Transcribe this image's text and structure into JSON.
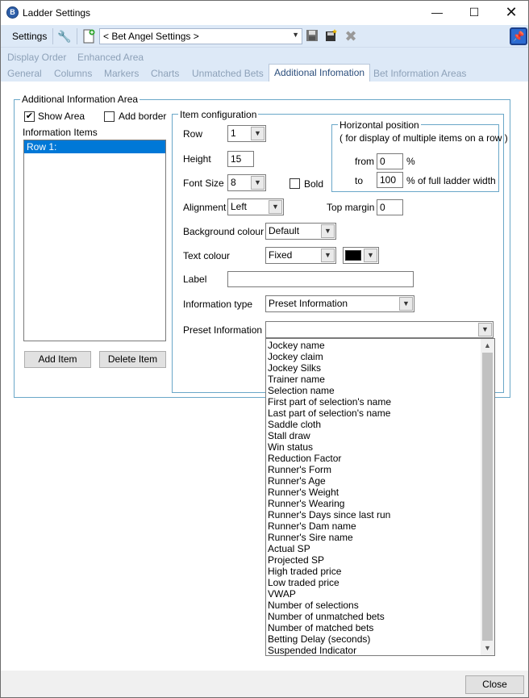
{
  "window": {
    "title": "Ladder Settings"
  },
  "toolbar": {
    "settings_label": "Settings",
    "profile_value": "< Bet Angel Settings >"
  },
  "tabs_row1": [
    "Display Order",
    "Enhanced Area"
  ],
  "tabs_row2": [
    "General",
    "Columns",
    "Markers",
    "Charts",
    "Unmatched Bets",
    "Additional Infomation",
    "Bet Information Areas"
  ],
  "area": {
    "group_label": "Additional Information Area",
    "show_area": "Show Area",
    "add_border": "Add border",
    "items_label": "Information Items",
    "items": [
      "Row 1:"
    ],
    "add_item": "Add Item",
    "delete_item": "Delete Item"
  },
  "config": {
    "group_label": "Item configuration",
    "row_label": "Row",
    "row_value": "1",
    "height_label": "Height",
    "height_value": "15",
    "font_size_label": "Font Size",
    "font_size_value": "8",
    "bold_label": "Bold",
    "alignment_label": "Alignment",
    "alignment_value": "Left",
    "top_margin_label": "Top margin",
    "top_margin_value": "0",
    "bg_colour_label": "Background colour",
    "bg_colour_value": "Default",
    "text_colour_label": "Text colour",
    "text_colour_value": "Fixed",
    "text_colour_swatch": "#000000",
    "label_label": "Label",
    "label_value": "",
    "info_type_label": "Information type",
    "info_type_value": "Preset Information",
    "preset_label": "Preset Information",
    "preset_value": ""
  },
  "hpos": {
    "group_label": "Horizontal position",
    "note": "( for display of multiple items on a row )",
    "from_label": "from",
    "from_value": "0",
    "from_unit": "%",
    "to_label": "to",
    "to_value": "100",
    "to_unit": "% of full ladder width"
  },
  "preset_options": [
    "Jockey name",
    "Jockey claim",
    "Jockey Silks",
    "Trainer name",
    "Selection name",
    "First part of selection's name",
    "Last part of selection's name",
    "Saddle cloth",
    "Stall draw",
    "Win status",
    "Reduction Factor",
    "Runner's Form",
    "Runner's Age",
    "Runner's Weight",
    "Runner's Wearing",
    "Runner's Days since last run",
    "Runner's Dam name",
    "Runner's Sire name",
    "Actual SP",
    "Projected SP",
    "High traded price",
    "Low traded price",
    "VWAP",
    "Number of selections",
    "Number of unmatched bets",
    "Number of matched bets",
    "Betting Delay (seconds)",
    "Suspended Indicator"
  ],
  "footer": {
    "close_label": "Close"
  }
}
